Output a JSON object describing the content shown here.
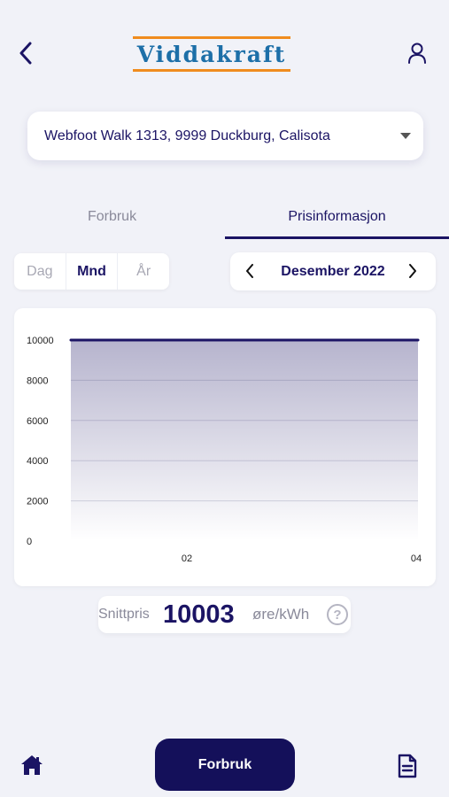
{
  "header": {
    "logo_text": "Viddakraft",
    "back_icon": "chevron-left-icon",
    "profile_icon": "user-icon"
  },
  "address": {
    "value": "Webfoot Walk 1313, 9999 Duckburg, Calisota"
  },
  "tabs": [
    {
      "label": "Forbruk",
      "active": false
    },
    {
      "label": "Prisinformasjon",
      "active": true
    }
  ],
  "period_selector": {
    "options": [
      "Dag",
      "Mnd",
      "År"
    ],
    "selected": "Mnd"
  },
  "month_picker": {
    "label": "Desember 2022"
  },
  "chart_data": {
    "type": "area",
    "title": "",
    "xlabel": "",
    "ylabel": "",
    "x": [
      "02",
      "04"
    ],
    "x_ticks": [
      "02",
      "04"
    ],
    "y_ticks": [
      0,
      2000,
      4000,
      6000,
      8000,
      10000
    ],
    "ylim": [
      0,
      10000
    ],
    "grid": true,
    "series": [
      {
        "values": [
          10000,
          10000
        ],
        "color": "#1b1464"
      }
    ]
  },
  "average_price": {
    "label": "Snittpris",
    "value": "10003",
    "unit": "øre/kWh",
    "help_icon": "?"
  },
  "bottom_nav": {
    "home_icon": "home-icon",
    "primary_button_label": "Forbruk",
    "document_icon": "document-icon"
  },
  "colors": {
    "primary": "#1b1464",
    "logo_blue": "#1d6fa8",
    "logo_orange": "#f08c1e",
    "background": "#f1f2f8"
  }
}
